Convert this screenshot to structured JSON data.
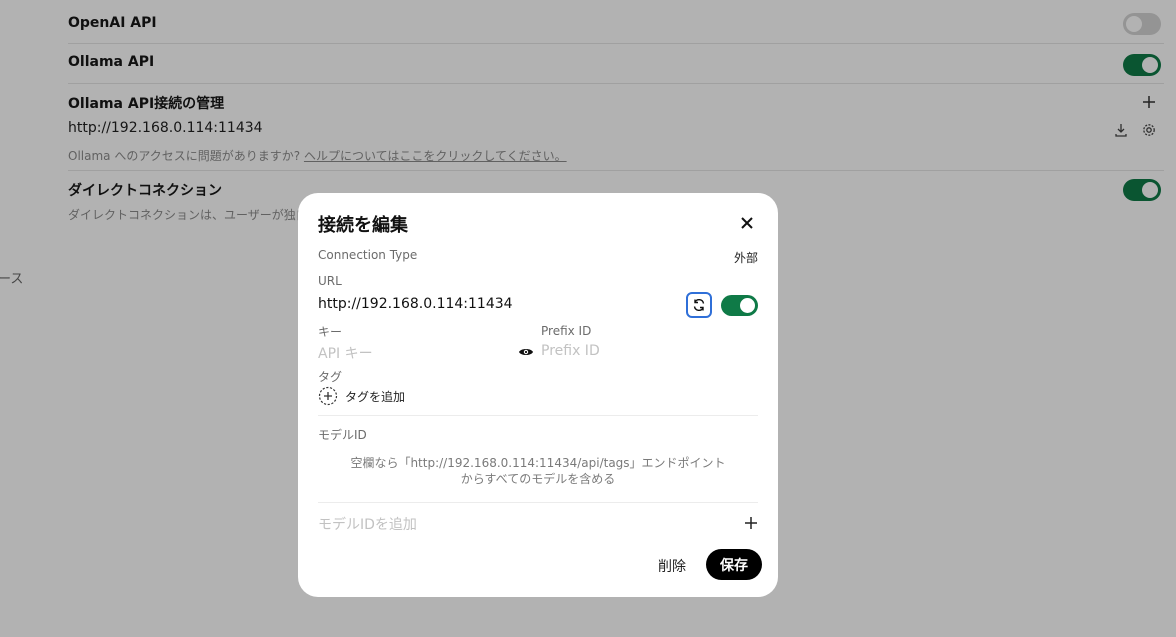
{
  "settings": {
    "openai_api_label": "OpenAI API",
    "ollama_api_label": "Ollama API",
    "manage_label": "Ollama API接続の管理",
    "connection_url": "http://192.168.0.114:11434",
    "help_prefix": "Ollama へのアクセスに問題がありますか?",
    "help_link": "ヘルプについてはここをクリックしてください。",
    "direct_label": "ダイレクトコネクション",
    "direct_desc": "ダイレクトコネクションは、ユーザーが独自",
    "side_fragment": "ース",
    "toggles": {
      "openai_api": false,
      "ollama_api": true,
      "direct": true
    }
  },
  "modal": {
    "title": "接続を編集",
    "connection_type_label": "Connection Type",
    "connection_type_value": "外部",
    "url_label": "URL",
    "url_value": "http://192.168.0.114:11434",
    "url_enabled": true,
    "key_label": "キー",
    "key_placeholder": "API キー",
    "prefix_label": "Prefix ID",
    "prefix_placeholder": "Prefix ID",
    "tags_label": "タグ",
    "add_tag_label": "タグを追加",
    "model_ids_label": "モデルID",
    "model_ids_hint_line1": "空欄なら「http://192.168.0.114:11434/api/tags」エンドポイント",
    "model_ids_hint_line2": "からすべてのモデルを含める",
    "add_model_placeholder": "モデルIDを追加",
    "delete_label": "削除",
    "save_label": "保存"
  },
  "colors": {
    "toggle_on": "#0f7a47",
    "focus_ring": "#2f6fd8",
    "overlay": "rgba(0,0,0,0.30)"
  }
}
